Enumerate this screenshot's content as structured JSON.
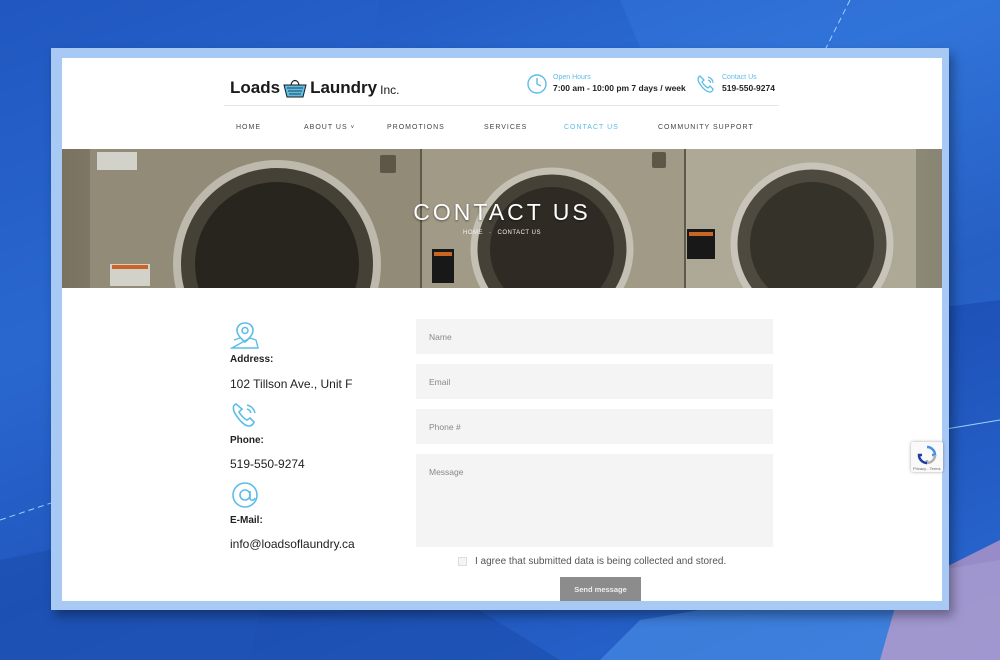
{
  "header": {
    "logo": {
      "word1": "Loads",
      "word2": "Laundry",
      "suffix": "Inc."
    },
    "hours": {
      "label": "Open Hours",
      "value": "7:00 am - 10:00 pm 7 days / week"
    },
    "contact": {
      "label": "Contact Us",
      "value": "519-550-9274"
    }
  },
  "nav": {
    "items": [
      {
        "label": "HOME"
      },
      {
        "label": "ABOUT US"
      },
      {
        "label": "PROMOTIONS"
      },
      {
        "label": "SERVICES"
      },
      {
        "label": "CONTACT US",
        "active": true
      },
      {
        "label": "COMMUNITY SUPPORT"
      }
    ],
    "active_color": "#5cbde8"
  },
  "hero": {
    "title": "CONTACT US",
    "breadcrumb": [
      "HOME",
      "CONTACT US"
    ]
  },
  "contact_info": {
    "address": {
      "icon": "map-pin-icon",
      "label": "Address:",
      "value": "102 Tillson Ave., Unit F"
    },
    "phone": {
      "icon": "phone-icon",
      "label": "Phone:",
      "value": "519-550-9274"
    },
    "email": {
      "icon": "at-sign-icon",
      "label": "E-Mail:",
      "value": "info@loadsoflaundry.ca"
    }
  },
  "form": {
    "name_placeholder": "Name",
    "email_placeholder": "Email",
    "phone_placeholder": "Phone #",
    "message_placeholder": "Message",
    "consent_text": "I agree that submitted data is being collected and stored.",
    "submit_label": "Send message"
  },
  "recaptcha": {
    "terms_text": "Privacy - Terms"
  },
  "colors": {
    "accent": "#5cbde8",
    "button": "#8c8c8c",
    "field_bg": "#f4f4f4"
  }
}
